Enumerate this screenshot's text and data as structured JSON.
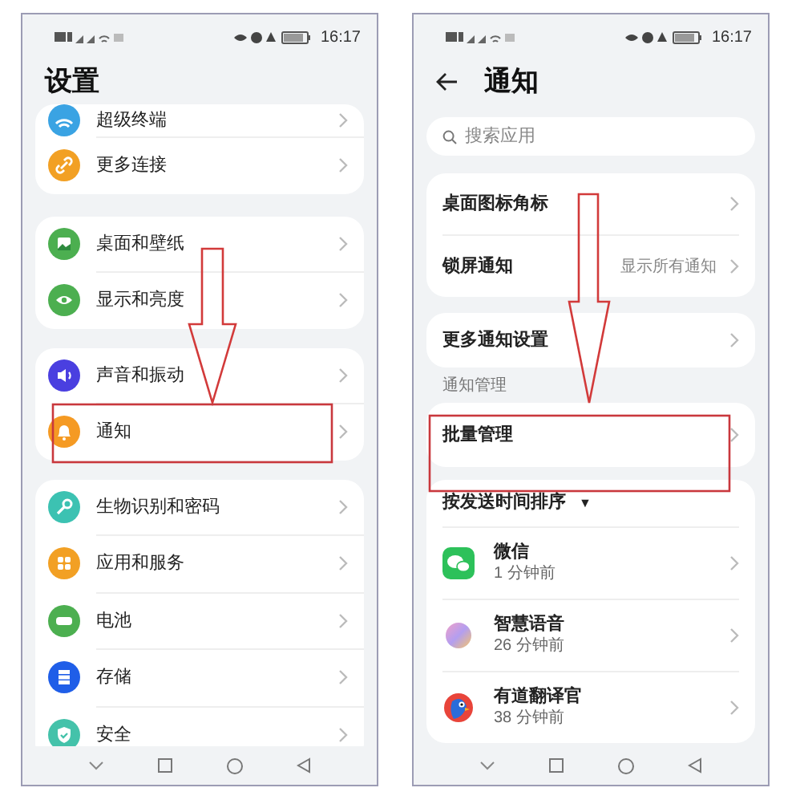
{
  "screens": [
    {
      "kind": "settings",
      "status_time": "16:17",
      "title": "设置",
      "groups": [
        [
          {
            "label": "超级终端",
            "color": "#3aa3e3"
          },
          {
            "label": "更多连接",
            "color": "#f2a024"
          }
        ],
        [
          {
            "label": "桌面和壁纸",
            "color": "#4caf50"
          },
          {
            "label": "显示和亮度",
            "color": "#4caf50"
          }
        ],
        [
          {
            "label": "声音和振动",
            "color": "#4a3fe0"
          },
          {
            "label": "通知",
            "color": "#f59a23"
          }
        ],
        [
          {
            "label": "生物识别和密码",
            "color": "#3cc2b2"
          },
          {
            "label": "应用和服务",
            "color": "#f2a024"
          },
          {
            "label": "电池",
            "color": "#4caf50"
          },
          {
            "label": "存储",
            "color": "#1f5ee8"
          },
          {
            "label": "安全",
            "color": "#44c2aa"
          }
        ]
      ]
    },
    {
      "kind": "notifications",
      "status_time": "16:17",
      "title": "通知",
      "search": {
        "placeholder": "搜索应用"
      },
      "groups": [
        [
          {
            "label": "桌面图标角标"
          },
          {
            "label": "锁屏通知",
            "value": "显示所有通知"
          }
        ],
        [
          {
            "label": "更多通知设置"
          }
        ]
      ],
      "section": "通知管理",
      "batch": {
        "label": "批量管理"
      },
      "sort": {
        "label": "按发送时间排序",
        "caret": "▼"
      },
      "apps": [
        {
          "name": "微信",
          "time": "1 分钟前"
        },
        {
          "name": "智慧语音",
          "time": "26 分钟前"
        },
        {
          "name": "有道翻译官",
          "time": "38 分钟前"
        }
      ]
    }
  ]
}
